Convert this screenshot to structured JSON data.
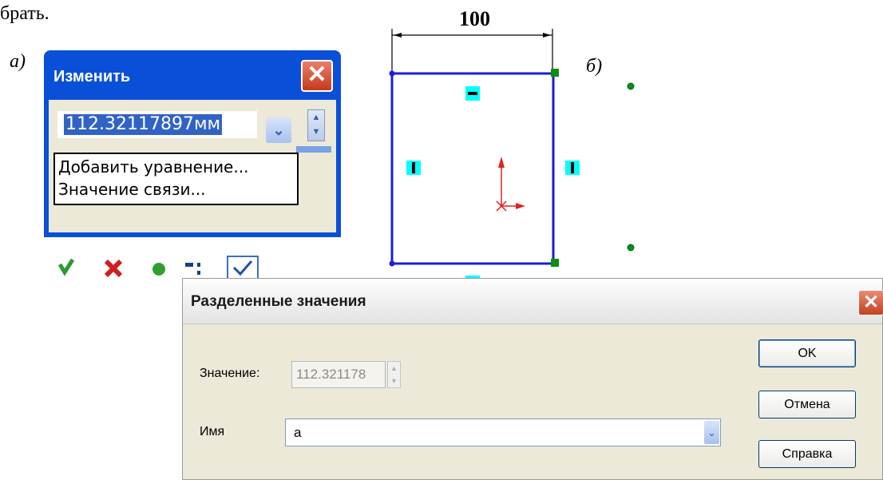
{
  "doc": {
    "top_text": "брать.",
    "label_a": "а)",
    "label_b": "б)"
  },
  "dialog_modify": {
    "title": "Изменить",
    "close_glyph": "✕",
    "value": "112.32117897мм",
    "menu_items": [
      "Добавить уравнение...",
      "Значение связи..."
    ],
    "toolbar_icons": [
      "check-icon",
      "cancel-icon",
      "rebuild-icon",
      "reverse-icon",
      "checkbox-icon"
    ]
  },
  "sketch": {
    "dimension_label": "100"
  },
  "dialog_linked": {
    "title": "Разделенные значения",
    "close_glyph": "✕",
    "value_label": "Значение:",
    "value": "112.321178",
    "name_label": "Имя",
    "name_value": "a",
    "buttons": {
      "ok": "OK",
      "cancel": "Отмена",
      "help": "Справка"
    }
  },
  "colors": {
    "xp_title_blue": "#0a4fd8",
    "sketch_line": "#1c1cdc",
    "handle_cyan": "#00ffff",
    "endpoint_green": "#0a8f0a"
  }
}
